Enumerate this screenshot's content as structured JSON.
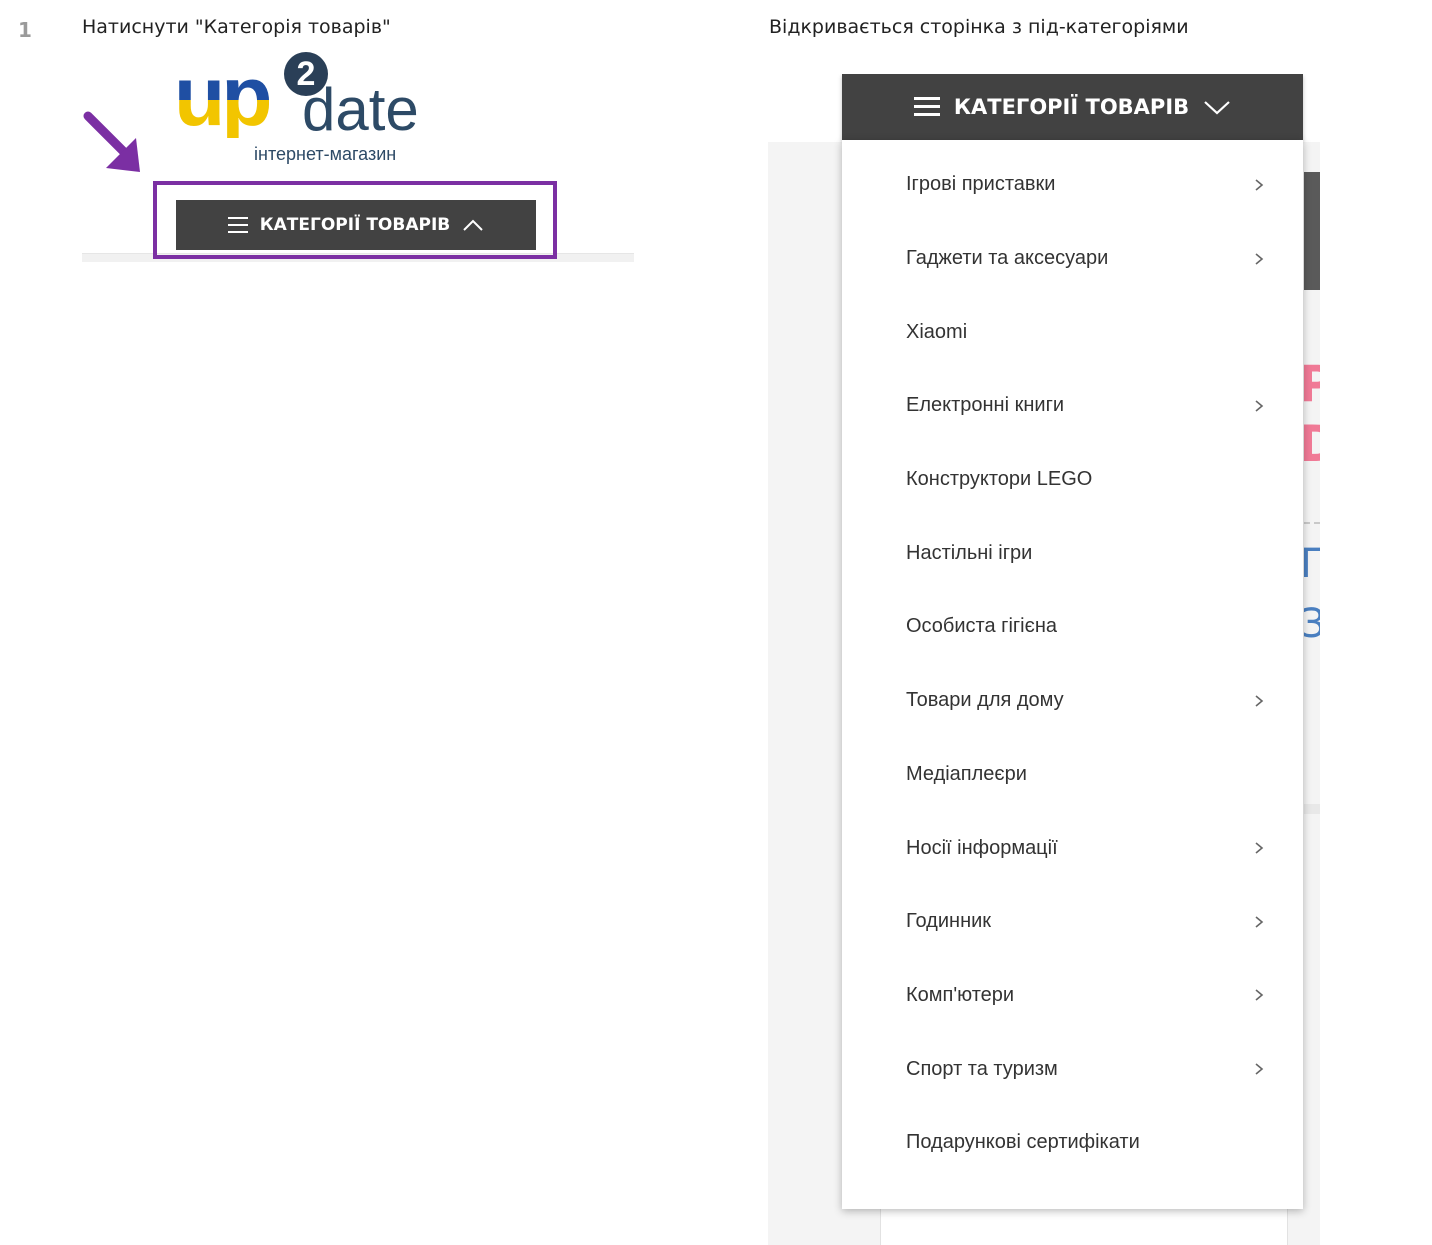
{
  "step": {
    "number": "1"
  },
  "captions": {
    "left": "Натиснути \"Категорія товарів\"",
    "right": "Відкривається сторінка з під-категоріями"
  },
  "logo": {
    "up": "up",
    "two": "2",
    "date": "date",
    "subtitle": "інтернет-магазин"
  },
  "colors": {
    "highlight": "#7b2fa3",
    "button_bg": "#424242",
    "logo_blue": "#1f4fa3",
    "logo_yellow": "#f2c500"
  },
  "icons": {
    "pointer": "arrow-down-right-icon",
    "menu": "hamburger-icon",
    "expand": "chevron-down-icon",
    "collapse": "chevron-up-icon",
    "submenu": "chevron-right-icon"
  },
  "left_screen": {
    "button_label": "КАТЕГОРІЇ ТОВАРІВ"
  },
  "right_screen": {
    "header_label": "КАТЕГОРІЇ ТОВАРІВ",
    "categories": [
      {
        "label": "Ігрові приставки",
        "has_sub": true
      },
      {
        "label": "Гаджети та аксесуари",
        "has_sub": true
      },
      {
        "label": "Xiaomi",
        "has_sub": false
      },
      {
        "label": "Електронні книги",
        "has_sub": true
      },
      {
        "label": "Конструктори LEGO",
        "has_sub": false
      },
      {
        "label": "Настільні ігри",
        "has_sub": false
      },
      {
        "label": "Особиста гігієна",
        "has_sub": false
      },
      {
        "label": "Товари для дому",
        "has_sub": true
      },
      {
        "label": "Медіаплеєри",
        "has_sub": false
      },
      {
        "label": "Носії інформації",
        "has_sub": true
      },
      {
        "label": "Годинник",
        "has_sub": true
      },
      {
        "label": "Комп'ютери",
        "has_sub": true
      },
      {
        "label": "Спорт та туризм",
        "has_sub": true
      },
      {
        "label": "Подарункові сертифікати",
        "has_sub": false
      }
    ]
  }
}
